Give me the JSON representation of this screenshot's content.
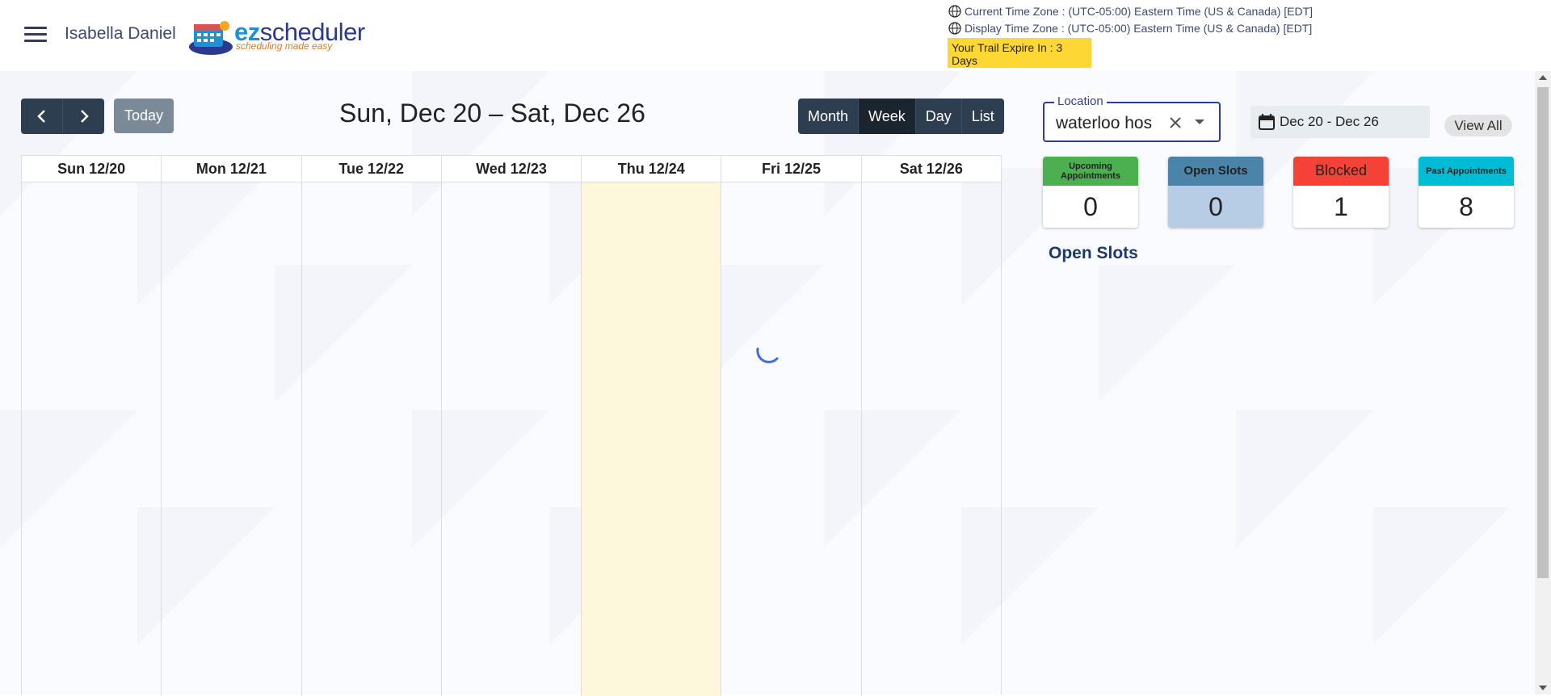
{
  "header": {
    "user_name": "Isabella Daniel",
    "logo": {
      "word_ez": "ez",
      "word_rest": "scheduler",
      "tagline": "scheduling made easy"
    },
    "current_tz": "Current Time Zone : (UTC-05:00) Eastern Time (US & Canada) [EDT]",
    "display_tz": "Display Time Zone : (UTC-05:00) Eastern Time (US & Canada) [EDT]",
    "trial_notice": "Your Trail Expire In : 3 Days"
  },
  "toolbar": {
    "prev_icon": "chevron-left-icon",
    "next_icon": "chevron-right-icon",
    "today_label": "Today",
    "range_title": "Sun, Dec 20 – Sat, Dec 26",
    "views": [
      "Month",
      "Week",
      "Day",
      "List"
    ],
    "active_view": "Week"
  },
  "calendar": {
    "days": [
      "Sun 12/20",
      "Mon 12/21",
      "Tue 12/22",
      "Wed 12/23",
      "Thu 12/24",
      "Fri 12/25",
      "Sat 12/26"
    ],
    "today_index": 4
  },
  "filters": {
    "location_label": "Location",
    "location_value": "waterloo hospital",
    "date_range": "Dec 20 - Dec 26",
    "view_all_label": "View All"
  },
  "stats": {
    "upcoming": {
      "label": "Upcoming Appointments",
      "value": "0",
      "color": "#4caf50"
    },
    "open": {
      "label": "Open Slots",
      "value": "0",
      "color": "#4a84a8"
    },
    "blocked": {
      "label": "Blocked",
      "value": "1",
      "color": "#f44336"
    },
    "past": {
      "label": "Past Appointments",
      "value": "8",
      "color": "#00bcd4"
    }
  },
  "open_slots_title": "Open Slots",
  "colors": {
    "primary_dark": "#2c3e50",
    "today_highlight": "#fdf8dc",
    "trial_bg": "#fdd835"
  }
}
